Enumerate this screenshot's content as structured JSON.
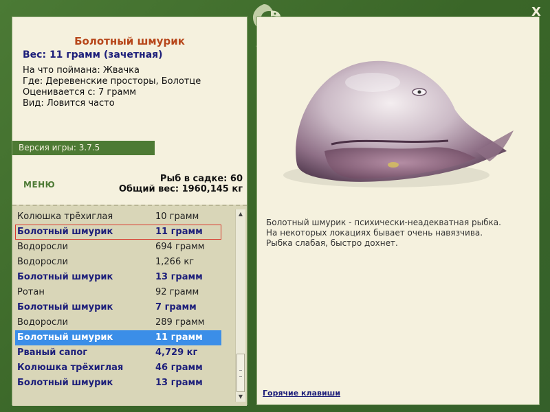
{
  "window": {
    "close_label": "X"
  },
  "fish_info": {
    "title": "Болотный шмурик",
    "weight_line": "Вес: 11 грамм (зачетная)",
    "caught_on": "На что поймана: Жвачка",
    "location": "Где: Деревенские просторы, Болотце",
    "min_weight": "Оценивается с: 7 грамм",
    "frequency": "Вид: Ловится часто"
  },
  "version_label": "Версия игры: 3.7.5",
  "menu_label": "МЕНЮ",
  "stats": {
    "fish_count": "Рыб в садке: 60",
    "total_weight": "Общий вес: 1960,145 кг"
  },
  "catch_list": [
    {
      "name": "Колюшка трёхиглая",
      "weight": "10 грамм",
      "style": "normal"
    },
    {
      "name": "Болотный шмурик",
      "weight": "11 грамм",
      "style": "boxed"
    },
    {
      "name": "Водоросли",
      "weight": "694 грамм",
      "style": "normal"
    },
    {
      "name": "Водоросли",
      "weight": "1,266 кг",
      "style": "normal"
    },
    {
      "name": "Болотный шмурик",
      "weight": "13 грамм",
      "style": "bold"
    },
    {
      "name": "Ротан",
      "weight": "92 грамм",
      "style": "normal"
    },
    {
      "name": "Болотный шмурик",
      "weight": "7 грамм",
      "style": "bold"
    },
    {
      "name": "Водоросли",
      "weight": "289 грамм",
      "style": "normal"
    },
    {
      "name": "Болотный шмурик",
      "weight": "11 грамм",
      "style": "selected"
    },
    {
      "name": "Рваный сапог",
      "weight": "4,729 кг",
      "style": "bold"
    },
    {
      "name": "Колюшка трёхиглая",
      "weight": "46 грамм",
      "style": "bold"
    },
    {
      "name": "Болотный шмурик",
      "weight": "13 грамм",
      "style": "bold"
    }
  ],
  "description": {
    "line1": "Болотный шмурик - психически-неадекватная рыбка.",
    "line2": "На некоторых локациях бывает очень навязчива.",
    "line3": "Рыбка слабая, быстро дохнет."
  },
  "hotkeys_label": "Горячие клавиши",
  "colors": {
    "frame_green": "#3e6b2c",
    "panel_cream": "#f5f1de",
    "title_orange": "#b7471b",
    "text_navy": "#1d1f7a",
    "selection_blue": "#3b8ee8",
    "highlight_red": "#d8372a"
  },
  "icons": {
    "logo": "fish-logo-icon",
    "close": "close-icon",
    "scroll_up": "arrow-up-icon",
    "scroll_down": "arrow-down-icon"
  }
}
